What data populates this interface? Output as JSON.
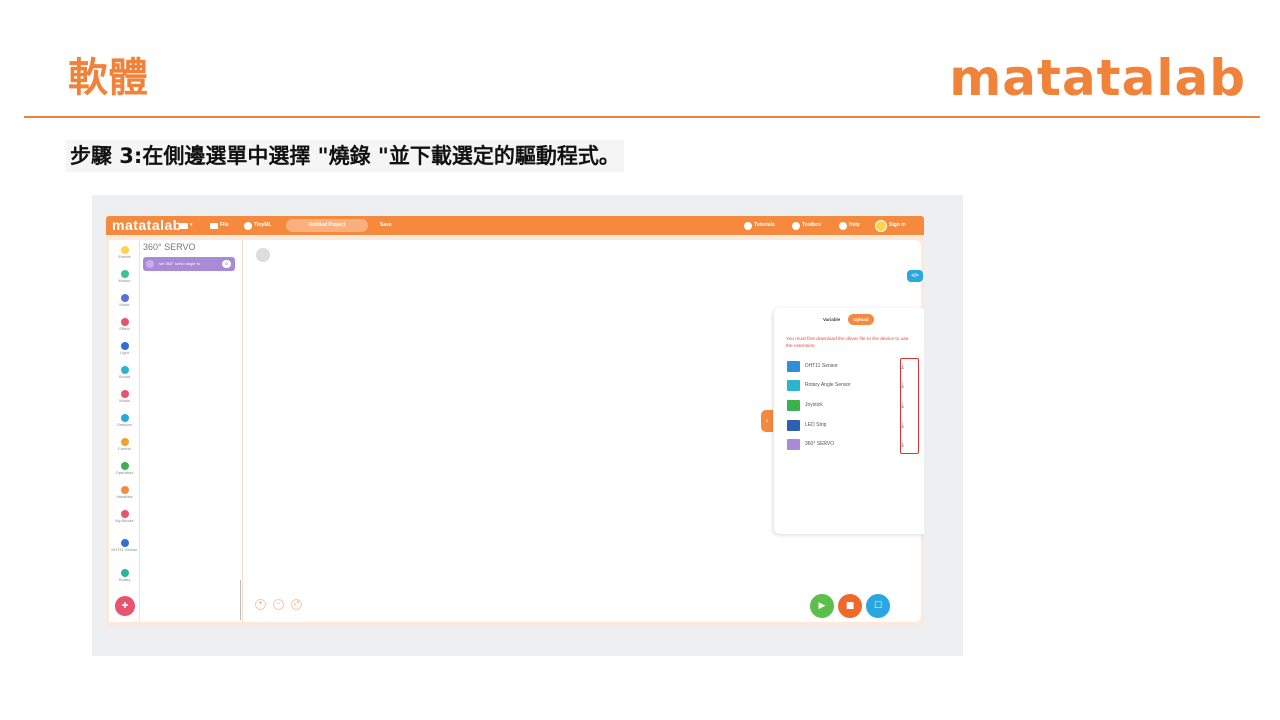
{
  "slide": {
    "title": "軟體",
    "brand": "matatalab",
    "step": "步驟 3:在側邊選單中選擇 \"燒錄 \"並下載選定的驅動程式。"
  },
  "app": {
    "logo": "matatalab",
    "menu": {
      "file": "File",
      "tinyml": "TinyML",
      "project_name": "Untitled Project",
      "save": "Save",
      "tutorials": "Tutorials",
      "toolbox": "Toolbox",
      "help": "Help",
      "sign_in": "Sign in"
    },
    "categories": [
      {
        "label": "Events",
        "color": "#ffd24a"
      },
      {
        "label": "Motion",
        "color": "#3cc48e"
      },
      {
        "label": "Motor",
        "color": "#5b6fd6"
      },
      {
        "label": "Effect",
        "color": "#e8546d"
      },
      {
        "label": "Light",
        "color": "#2f6fd6"
      },
      {
        "label": "Sound",
        "color": "#2ab5c8"
      },
      {
        "label": "Music",
        "color": "#e8546d"
      },
      {
        "label": "Sensors",
        "color": "#2aa7e0"
      },
      {
        "label": "Control",
        "color": "#f2a12f"
      },
      {
        "label": "Operators",
        "color": "#3cb04a"
      },
      {
        "label": "Variables",
        "color": "#f5893d"
      },
      {
        "label": "My Blocks",
        "color": "#e8546d"
      },
      {
        "label": "DHT11 Sensor",
        "color": "#2f6fd6"
      },
      {
        "label": "Rotary",
        "color": "#2ab59a"
      }
    ],
    "palette": {
      "title": "360° SERVO",
      "block_label": "set 360° servo angle to",
      "block_value": "0"
    },
    "colors": {
      "accent": "#f5893d",
      "notice": "#e84a3a",
      "highlight": "#e0322e"
    },
    "panel": {
      "tabs": [
        "Variable",
        "Upload"
      ],
      "active_tab": "Upload",
      "notice": "You must first download the driver file to the device to use the extension",
      "drivers": [
        {
          "name": "DHT11 Sensor",
          "thumb": "#2f8fd6"
        },
        {
          "name": "Rotary Angle Sensor",
          "thumb": "#2ab5c8"
        },
        {
          "name": "Joystick",
          "thumb": "#3cb04a"
        },
        {
          "name": "LED Strip",
          "thumb": "#2f5fae"
        },
        {
          "name": "360° SERVO",
          "thumb": "#a98ad6"
        }
      ],
      "download_icon": "⤓"
    }
  }
}
